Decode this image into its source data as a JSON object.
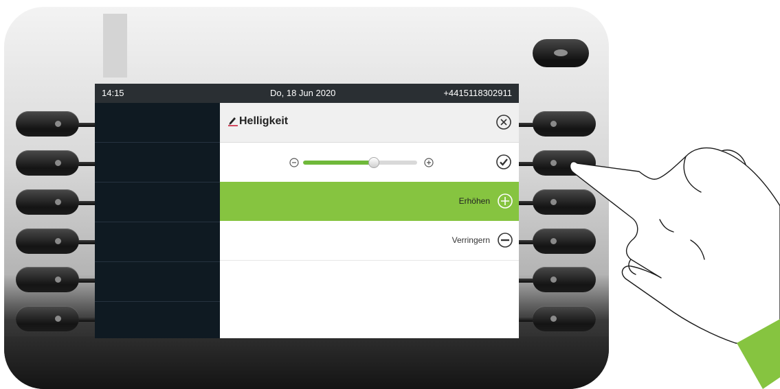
{
  "status_bar": {
    "time": "14:15",
    "date": "Do, 18 Jun 2020",
    "phone_number": "+4415118302911"
  },
  "menu": {
    "title": "Helligkeit",
    "brightness_level": 0.62,
    "items": [
      {
        "label": "Erhöhen",
        "icon": "plus-circle-icon",
        "selected": true
      },
      {
        "label": "Verringern",
        "icon": "minus-circle-icon",
        "selected": false
      }
    ]
  },
  "colors": {
    "accent": "#86c440",
    "slider_fill": "#6fb93a",
    "screen_background": "#101820",
    "status_bar": "#2a2f33",
    "hand_cuff": "#86c440"
  }
}
